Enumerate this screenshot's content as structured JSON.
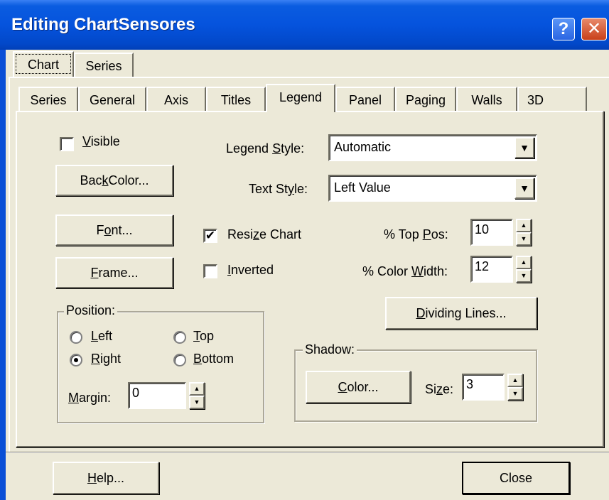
{
  "window": {
    "title": "Editing ChartSensores",
    "help_glyph": "?",
    "close_glyph": "✕"
  },
  "outer_tabs": [
    {
      "label": "Chart",
      "selected": true
    },
    {
      "label": "Series",
      "selected": false
    }
  ],
  "inner_tabs": [
    {
      "label": "Series"
    },
    {
      "label": "General"
    },
    {
      "label": "Axis"
    },
    {
      "label": "Titles"
    },
    {
      "label": "Legend",
      "selected": true
    },
    {
      "label": "Panel"
    },
    {
      "label": "Paging"
    },
    {
      "label": "Walls"
    },
    {
      "label": "3D"
    }
  ],
  "legend": {
    "visible": {
      "label_prefix": "",
      "mnemonic": "V",
      "label_rest": "isible",
      "checked": false
    },
    "back_color": {
      "pre": "Bac",
      "mn": "k",
      "post": " Color..."
    },
    "font": {
      "pre": "F",
      "mn": "o",
      "post": "nt..."
    },
    "frame": {
      "pre": "",
      "mn": "F",
      "post": "rame..."
    },
    "legend_style": {
      "pre": "Legend ",
      "mn": "S",
      "post": "tyle:",
      "value": "Automatic"
    },
    "text_style": {
      "pre": "Text St",
      "mn": "y",
      "post": "le:",
      "value": "Left Value"
    },
    "resize_chart": {
      "pre": "Resi",
      "mn": "z",
      "post": "e Chart",
      "checked": true,
      "check_glyph": "✔"
    },
    "inverted": {
      "pre": "",
      "mn": "I",
      "post": "nverted",
      "checked": false
    },
    "top_pos": {
      "pre": "% Top ",
      "mn": "P",
      "post": "os:",
      "value": "10"
    },
    "color_width": {
      "pre": "% Color ",
      "mn": "W",
      "post": "idth:",
      "value": "12"
    },
    "dividing_lines": {
      "pre": "",
      "mn": "D",
      "post": "ividing Lines..."
    },
    "position": {
      "title": "Position:",
      "left": {
        "pre": "",
        "mn": "L",
        "post": "eft",
        "checked": false
      },
      "right": {
        "pre": "",
        "mn": "R",
        "post": "ight",
        "checked": true
      },
      "top": {
        "pre": "",
        "mn": "T",
        "post": "op",
        "checked": false
      },
      "bottom": {
        "pre": "",
        "mn": "B",
        "post": "ottom",
        "checked": false
      },
      "margin": {
        "pre": "",
        "mn": "M",
        "post": "argin:",
        "value": "0"
      }
    },
    "shadow": {
      "title": "Shadow:",
      "color": {
        "pre": "",
        "mn": "C",
        "post": "olor..."
      },
      "size": {
        "pre": "Si",
        "mn": "z",
        "post": "e:",
        "value": "3"
      }
    }
  },
  "footer": {
    "help": {
      "pre": "",
      "mn": "H",
      "post": "elp..."
    },
    "close": "Close"
  },
  "glyphs": {
    "combo_arrow": "▼",
    "spin_up": "▲",
    "spin_down": "▼"
  }
}
